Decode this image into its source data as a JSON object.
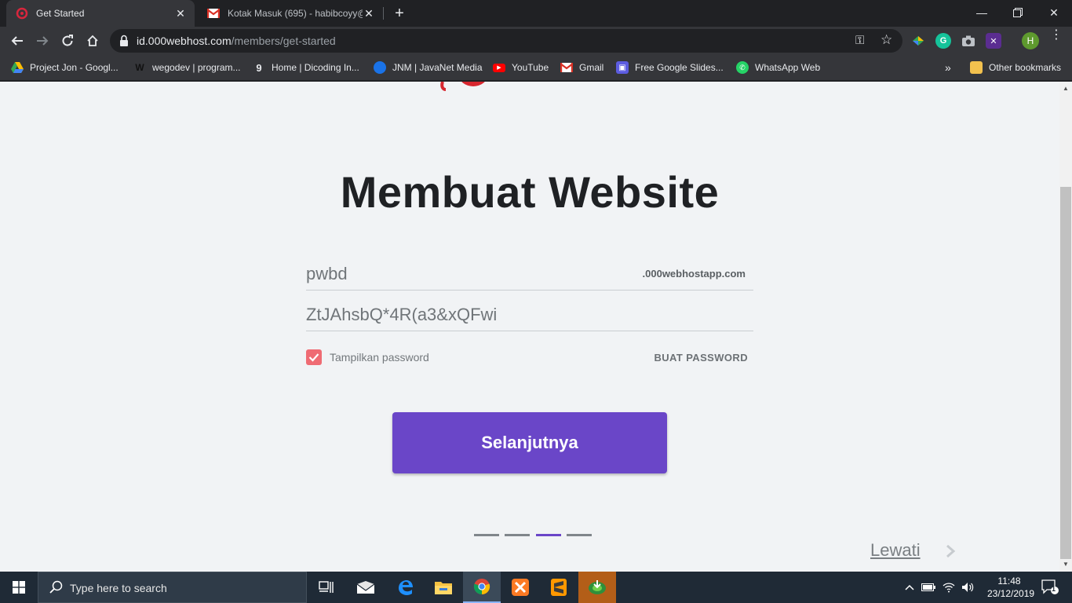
{
  "browser": {
    "tabs": [
      {
        "title": "Get Started",
        "active": true
      },
      {
        "title": "Kotak Masuk (695) - habibcoyy@",
        "active": false
      }
    ],
    "url_host": "id.000webhost.com",
    "url_path": "/members/get-started",
    "profile_initial": "H",
    "bookmarks": [
      "Project Jon - Googl...",
      "wegodev | program...",
      "Home | Dicoding In...",
      "JNM | JavaNet Media",
      "YouTube",
      "Gmail",
      "Free Google Slides...",
      "WhatsApp Web"
    ],
    "bookmarks_overflow": "»",
    "other_bookmarks": "Other bookmarks"
  },
  "page": {
    "heading": "Membuat Website",
    "site_name_value": "pwbd",
    "site_suffix": ".000webhostapp.com",
    "password_value": "ZtJAhsbQ*4R(a3&xQFwi",
    "show_password_label": "Tampilkan password",
    "show_password_checked": true,
    "generate_password_label": "BUAT PASSWORD",
    "next_button_label": "Selanjutnya",
    "steps_total": 4,
    "step_current": 3,
    "skip_label": "Lewati",
    "accent_color": "#6a46c8",
    "checkbox_color": "#ef6b73"
  },
  "taskbar": {
    "search_placeholder": "Type here to search",
    "time": "11:48",
    "date": "23/12/2019",
    "notification_count": "1"
  }
}
